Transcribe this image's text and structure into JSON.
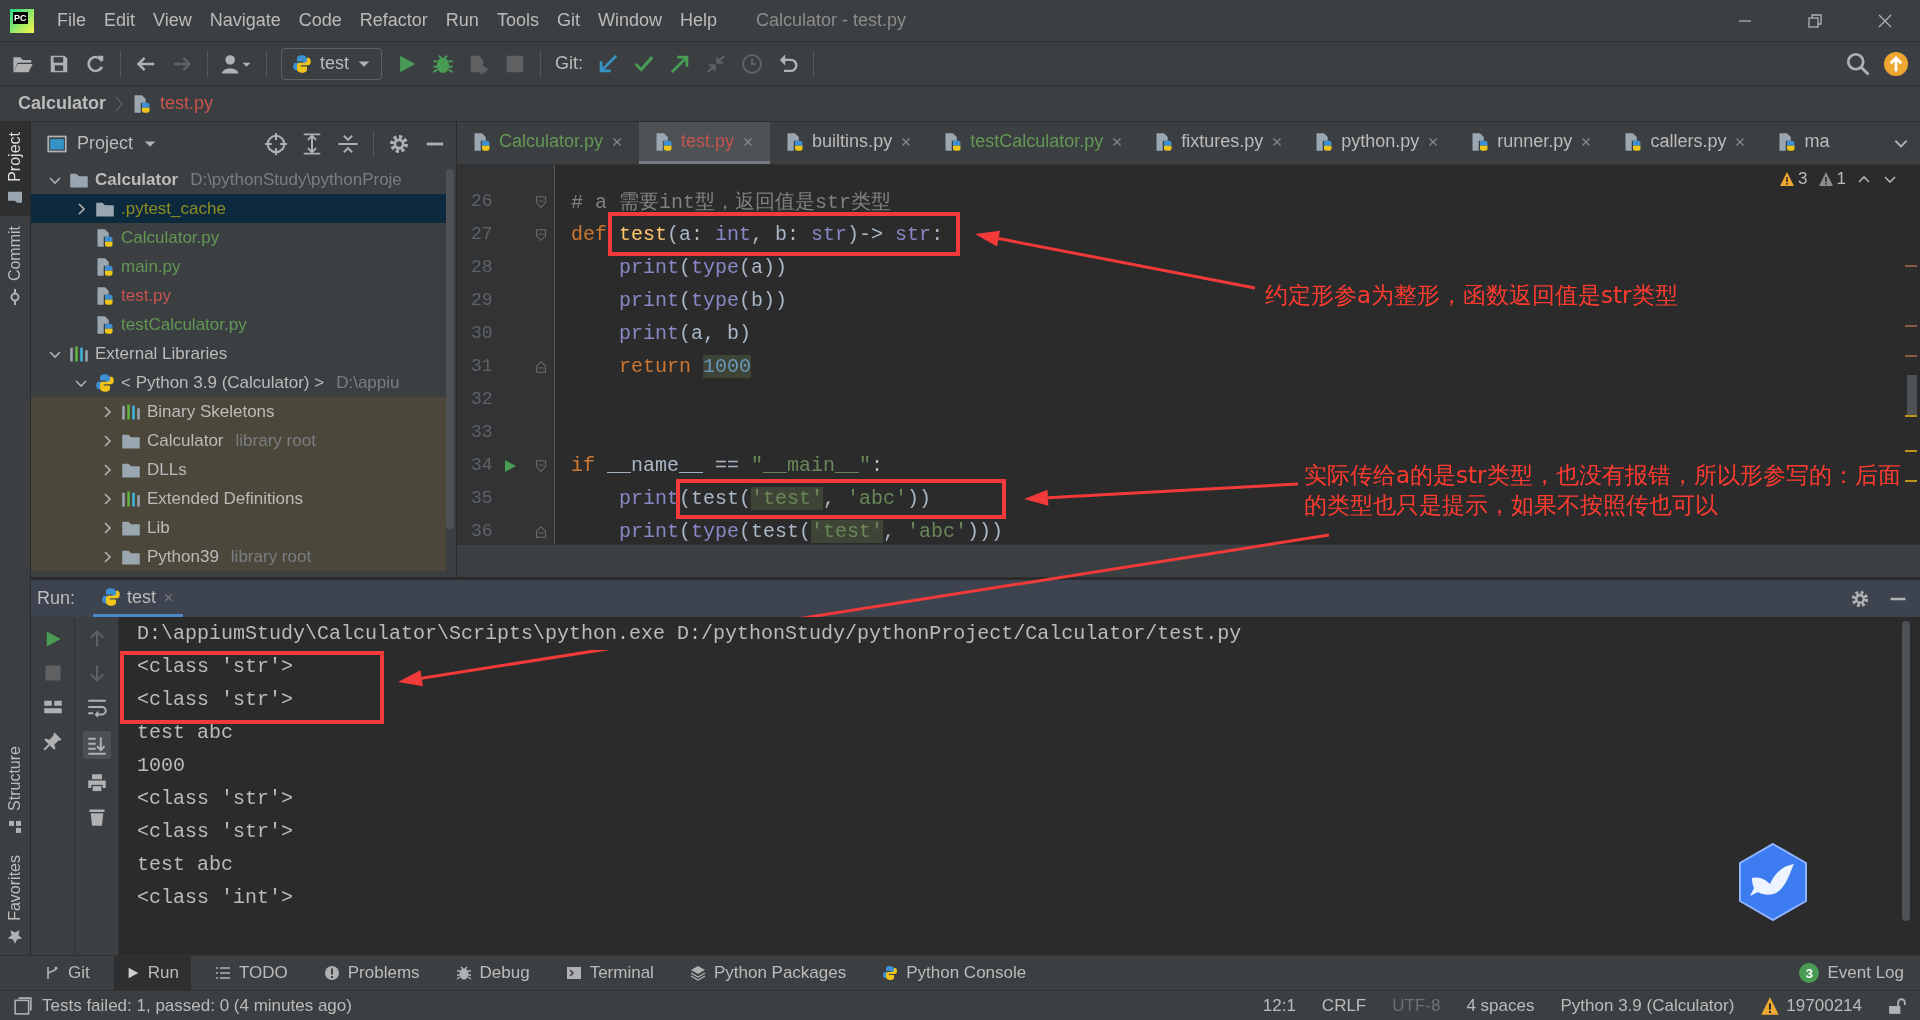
{
  "title_bar": {
    "logo": "PC",
    "menus": [
      "File",
      "Edit",
      "View",
      "Navigate",
      "Code",
      "Refactor",
      "Run",
      "Tools",
      "Git",
      "Window",
      "Help"
    ],
    "title": "Calculator - test.py"
  },
  "toolbar": {
    "run_config": "test",
    "git_label": "Git:"
  },
  "breadcrumb": [
    {
      "label": "Calculator",
      "kind": "project"
    },
    {
      "label": "test.py",
      "kind": "file",
      "color": "#c75450"
    }
  ],
  "side_tabs": [
    {
      "label": "Project",
      "kind": "project",
      "selected": true
    },
    {
      "label": "Commit",
      "kind": "commit",
      "selected": false
    }
  ],
  "side_tabs_bottom": [
    {
      "label": "Structure",
      "kind": "structure"
    },
    {
      "label": "Favorites",
      "kind": "favorites"
    }
  ],
  "project_panel": {
    "title": "Project",
    "tree": [
      {
        "label": "Calculator",
        "kind": "module",
        "hint": "D:\\pythonStudy\\pythonProje",
        "expanded": true,
        "selected": false,
        "children": [
          {
            "label": ".pytest_cache",
            "kind": "folder",
            "expanded": false,
            "selected": true,
            "color": "#8e8e22"
          },
          {
            "label": "Calculator.py",
            "kind": "python-file",
            "selected": false,
            "color": "#629755"
          },
          {
            "label": "main.py",
            "kind": "python-file",
            "selected": false,
            "color": "#629755"
          },
          {
            "label": "test.py",
            "kind": "python-file",
            "selected": false,
            "color": "#c75450"
          },
          {
            "label": "testCalculator.py",
            "kind": "python-file",
            "selected": false,
            "color": "#629755"
          }
        ]
      },
      {
        "label": "External Libraries",
        "kind": "library",
        "expanded": true,
        "selected": false,
        "children": [
          {
            "label": "< Python 3.9 (Calculator) >",
            "kind": "sdk",
            "hint": "D:\\appiu",
            "expanded": true,
            "selected": false,
            "children": [
              {
                "label": "Binary Skeletons",
                "kind": "library",
                "expanded": false,
                "selected": false
              },
              {
                "label": "Calculator",
                "kind": "folder",
                "hint": "library root",
                "expanded": false,
                "selected": false
              },
              {
                "label": "DLLs",
                "kind": "folder",
                "expanded": false,
                "selected": false
              },
              {
                "label": "Extended Definitions",
                "kind": "library",
                "expanded": false,
                "selected": false
              },
              {
                "label": "Lib",
                "kind": "folder",
                "expanded": false,
                "selected": false
              },
              {
                "label": "Python39",
                "kind": "folder",
                "hint": "library root",
                "expanded": false,
                "selected": false
              }
            ]
          }
        ]
      }
    ]
  },
  "editor": {
    "tabs": [
      {
        "label": "Calculator.py",
        "selected": false,
        "color": "#629755"
      },
      {
        "label": "test.py",
        "selected": true,
        "color": "#c75450"
      },
      {
        "label": "builtins.py",
        "selected": false,
        "color": "#bbbbbb"
      },
      {
        "label": "testCalculator.py",
        "selected": false,
        "color": "#629755"
      },
      {
        "label": "fixtures.py",
        "selected": false,
        "color": "#bbbbbb"
      },
      {
        "label": "python.py",
        "selected": false,
        "color": "#bbbbbb"
      },
      {
        "label": "runner.py",
        "selected": false,
        "color": "#bbbbbb"
      },
      {
        "label": "callers.py",
        "selected": false,
        "color": "#bbbbbb"
      },
      {
        "label": "ma",
        "selected": false,
        "color": "#bbbbbb"
      }
    ],
    "inspections": [
      {
        "kind": "warning",
        "count": "3"
      },
      {
        "kind": "weak-warning",
        "count": "1"
      }
    ],
    "lines": [
      {
        "number": "26",
        "fold_start": true,
        "tokens": [
          {
            "text": "# a 需要int型，返回值是str类型",
            "kind": "comment"
          }
        ]
      },
      {
        "number": "27",
        "fold_start": true,
        "tokens": [
          {
            "text": "def",
            "kind": "keyword"
          },
          {
            "text": "test",
            "kind": "function"
          },
          {
            "text": "(a: ",
            "kind": "plain"
          },
          {
            "text": "int",
            "kind": "builtin"
          },
          {
            "text": ", b: ",
            "kind": "plain"
          },
          {
            "text": "str",
            "kind": "builtin"
          },
          {
            "text": ")-> ",
            "kind": "plain"
          },
          {
            "text": "str",
            "kind": "builtin"
          },
          {
            "text": ":",
            "kind": "plain"
          }
        ]
      },
      {
        "number": "28",
        "indented": true,
        "tokens": [
          {
            "text": "print",
            "kind": "builtin"
          },
          {
            "text": "(",
            "kind": "plain"
          },
          {
            "text": "type",
            "kind": "builtin"
          },
          {
            "text": "(a))",
            "kind": "plain"
          }
        ]
      },
      {
        "number": "29",
        "indented": true,
        "tokens": [
          {
            "text": "print",
            "kind": "builtin"
          },
          {
            "text": "(",
            "kind": "plain"
          },
          {
            "text": "type",
            "kind": "builtin"
          },
          {
            "text": "(b))",
            "kind": "plain"
          }
        ]
      },
      {
        "number": "30",
        "indented": true,
        "tokens": [
          {
            "text": "print",
            "kind": "builtin"
          },
          {
            "text": "(a, b)",
            "kind": "plain"
          }
        ]
      },
      {
        "number": "31",
        "fold_end": true,
        "indented": true,
        "tokens": [
          {
            "text": "return",
            "kind": "keyword"
          },
          {
            "text": "1000",
            "kind": "number",
            "highlight": true
          }
        ]
      },
      {
        "number": "32"
      },
      {
        "number": "33"
      },
      {
        "number": "34",
        "fold_start": true,
        "run": true,
        "tokens": [
          {
            "text": "if",
            "kind": "keyword"
          },
          {
            "text": "__name__ == ",
            "kind": "plain"
          },
          {
            "text": "\"__main__\"",
            "kind": "string"
          },
          {
            "text": ":",
            "kind": "plain"
          }
        ]
      },
      {
        "number": "35",
        "indented": true,
        "tokens": [
          {
            "text": "print",
            "kind": "builtin"
          },
          {
            "text": "(test(",
            "kind": "plain"
          },
          {
            "text": "'test'",
            "kind": "string",
            "highlight": true
          },
          {
            "text": ", ",
            "kind": "plain"
          },
          {
            "text": "'abc'",
            "kind": "string"
          },
          {
            "text": "))",
            "kind": "plain"
          }
        ]
      },
      {
        "number": "36",
        "fold_end": true,
        "indented": true,
        "tokens": [
          {
            "text": "print",
            "kind": "builtin"
          },
          {
            "text": "(",
            "kind": "plain"
          },
          {
            "text": "type",
            "kind": "builtin"
          },
          {
            "text": "(test(",
            "kind": "plain"
          },
          {
            "text": "'test'",
            "kind": "string",
            "highlight": true
          },
          {
            "text": ", ",
            "kind": "plain"
          },
          {
            "text": "'abc'",
            "kind": "string"
          },
          {
            "text": ")))",
            "kind": "plain"
          }
        ]
      }
    ]
  },
  "run_panel": {
    "label": "Run:",
    "tab": "test",
    "autoscroll": true,
    "output": [
      "D:\\appiumStudy\\Calculator\\Scripts\\python.exe D:/pythonStudy/pythonProject/Calculator/test.py",
      "<class 'str'>",
      "<class 'str'>",
      "test abc",
      "1000",
      "<class 'str'>",
      "<class 'str'>",
      "test abc",
      "<class 'int'>"
    ]
  },
  "tool_windows": [
    {
      "label": "Git",
      "kind": "git",
      "selected": false
    },
    {
      "label": "Run",
      "kind": "run",
      "selected": true
    },
    {
      "label": "TODO",
      "kind": "todo",
      "selected": false
    },
    {
      "label": "Problems",
      "kind": "problems",
      "selected": false
    },
    {
      "label": "Debug",
      "kind": "debug",
      "selected": false
    },
    {
      "label": "Terminal",
      "kind": "terminal",
      "selected": false
    },
    {
      "label": "Python Packages",
      "kind": "packages",
      "selected": false
    },
    {
      "label": "Python Console",
      "kind": "console",
      "selected": false
    }
  ],
  "event_log": {
    "label": "Event Log",
    "count": "3"
  },
  "status_bar": {
    "message": "Tests failed: 1, passed: 0 (4 minutes ago)",
    "items": [
      {
        "text": "12:1",
        "disabled": false
      },
      {
        "text": "CRLF",
        "disabled": false
      },
      {
        "text": "UTF-8",
        "disabled": true
      },
      {
        "text": "4 spaces",
        "disabled": false
      },
      {
        "text": "Python 3.9 (Calculator)",
        "disabled": false
      }
    ],
    "warning_text": "19700214"
  },
  "annotations": [
    {
      "text": "约定形参a为整形，函数返回值是str类型"
    },
    {
      "text": "实际传给a的是str类型，也没有报错，所以形参写的：后面的类型也只是提示，如果不按照传也可以"
    }
  ]
}
